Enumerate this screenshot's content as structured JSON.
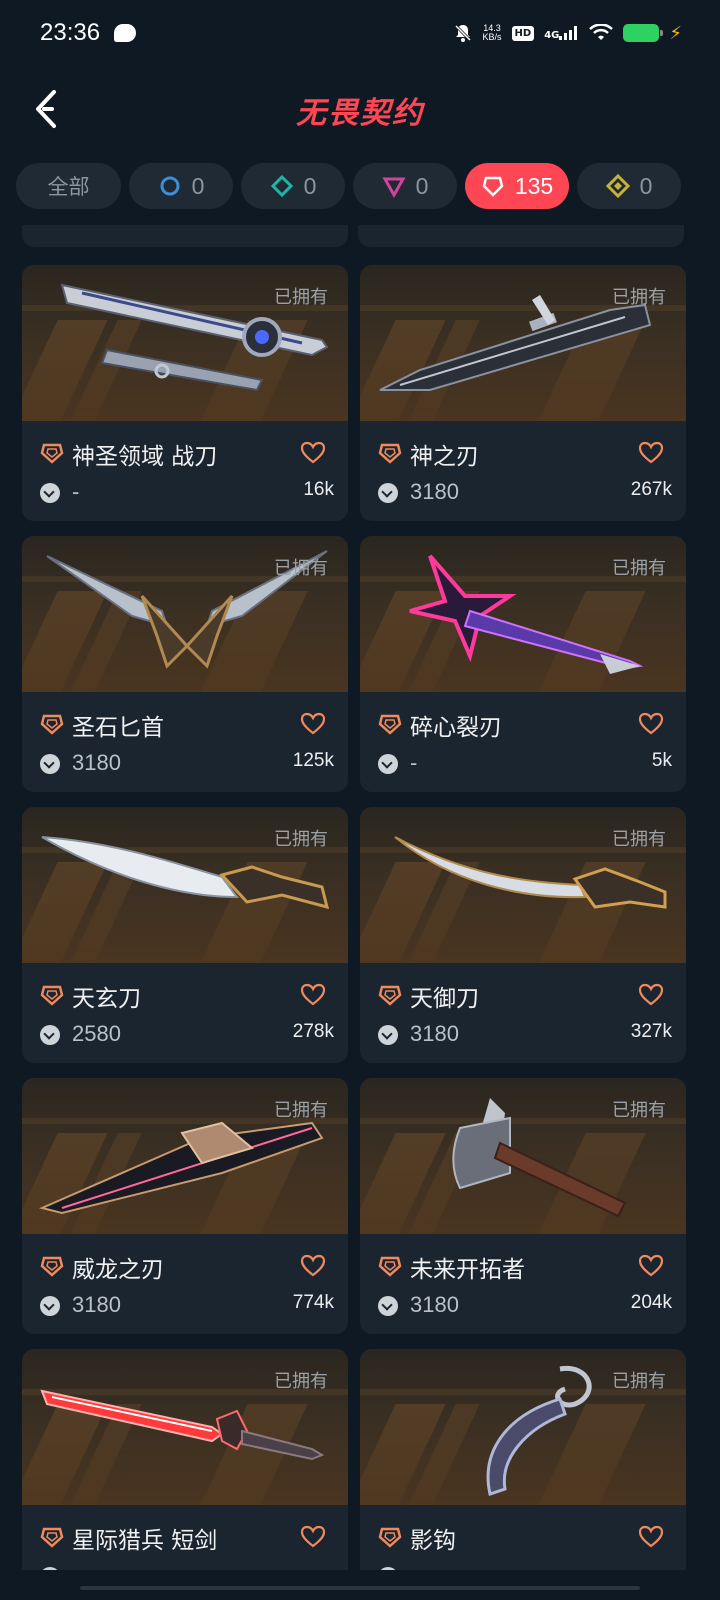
{
  "status_bar": {
    "time": "23:36",
    "net_speed_value": "14.3",
    "net_speed_unit": "KB/s",
    "hd": "HD",
    "signal": "4G",
    "icons": [
      "chat-bubble-icon",
      "mute-icon",
      "wifi-icon",
      "battery-icon",
      "charging-icon"
    ]
  },
  "header": {
    "title": "无畏契约",
    "back_icon": "chevron-left-icon"
  },
  "filters": [
    {
      "label": "全部",
      "icon": null,
      "active": false
    },
    {
      "label": "0",
      "icon": "circle-tier-icon",
      "color": "#3a8fd9",
      "active": false
    },
    {
      "label": "0",
      "icon": "diamond-tier-icon",
      "color": "#1fb5a5",
      "active": false
    },
    {
      "label": "0",
      "icon": "triangle-tier-icon",
      "color": "#d4439a",
      "active": false
    },
    {
      "label": "135",
      "icon": "pentagon-tier-icon",
      "color": "#ffffff",
      "active": true
    },
    {
      "label": "0",
      "icon": "square-diamond-tier-icon",
      "color": "#c9b23a",
      "active": false
    }
  ],
  "owned_label": "已拥有",
  "accent_color": "#ff4655",
  "tier_color": "#f08a5d",
  "items": [
    {
      "name": "神圣领域 战刀",
      "price": "-",
      "likes": "16k",
      "weapon": "sword"
    },
    {
      "name": "神之刃",
      "price": "3180",
      "likes": "267k",
      "weapon": "blade"
    },
    {
      "name": "圣石匕首",
      "price": "3180",
      "likes": "125k",
      "weapon": "wings"
    },
    {
      "name": "碎心裂刃",
      "price": "-",
      "likes": "5k",
      "weapon": "star"
    },
    {
      "name": "天玄刀",
      "price": "2580",
      "likes": "278k",
      "weapon": "knife-silver"
    },
    {
      "name": "天御刀",
      "price": "3180",
      "likes": "327k",
      "weapon": "knife-gold"
    },
    {
      "name": "威龙之刃",
      "price": "3180",
      "likes": "774k",
      "weapon": "dragon"
    },
    {
      "name": "未来开拓者",
      "price": "3180",
      "likes": "204k",
      "weapon": "axe"
    },
    {
      "name": "星际猎兵 短剑",
      "price": "",
      "likes": "",
      "weapon": "red-sword"
    },
    {
      "name": "影钩",
      "price": "",
      "likes": "",
      "weapon": "karambit"
    }
  ]
}
